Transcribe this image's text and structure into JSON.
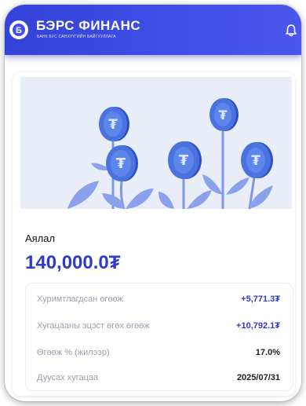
{
  "header": {
    "title": "БЭРС ФИНАНС",
    "subtitle": "БАНК БУС САНХҮҮГИЙН БАЙГУУЛЛАГА",
    "logo_icon": "bers-logo-icon",
    "bell_icon": "bell-icon"
  },
  "savings": {
    "name": "Аялал",
    "amount": "140,000.0₮",
    "details": [
      {
        "label": "Хуримтлагдсан өгөөж",
        "value": "+5,771.3₮"
      },
      {
        "label": "Хугацааны эцэст өгөх өгөөж",
        "value": "+10,792.1₮"
      },
      {
        "label": "Өгөөж % (жилээр)",
        "value": "17.0%"
      },
      {
        "label": "Дуусах хугацаа",
        "value": "2025/07/31"
      }
    ]
  },
  "colors": {
    "brand_blue": "#3f4fe8",
    "amount_blue": "#2d3bc6",
    "illustration_bg": "#e9edf8",
    "coin_blue": "#3a63d8"
  }
}
